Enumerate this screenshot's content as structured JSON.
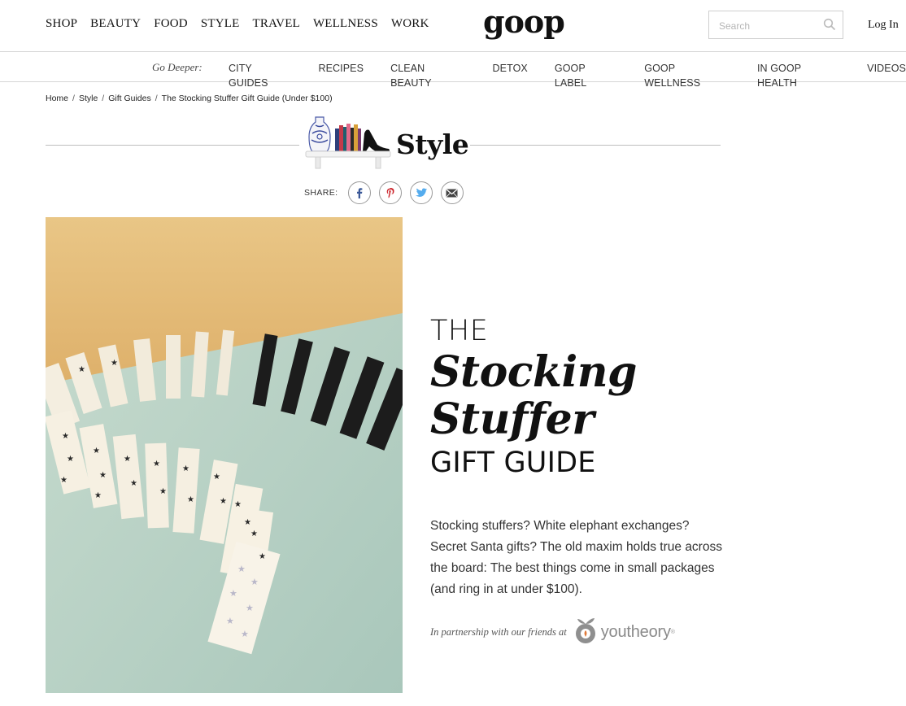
{
  "header": {
    "nav": [
      "SHOP",
      "BEAUTY",
      "FOOD",
      "STYLE",
      "TRAVEL",
      "WELLNESS",
      "WORK"
    ],
    "logo": "goop",
    "search_placeholder": "Search",
    "search_icon": "search-icon",
    "login": "Log In"
  },
  "subnav": {
    "label": "Go Deeper:",
    "items": [
      "CITY GUIDES",
      "RECIPES",
      "CLEAN BEAUTY",
      "DETOX",
      "GOOP LABEL",
      "GOOP WELLNESS",
      "IN GOOP HEALTH",
      "VIDEOS"
    ]
  },
  "breadcrumb": [
    "Home",
    "Style",
    "Gift Guides",
    "The Stocking Stuffer Gift Guide (Under $100)"
  ],
  "section": {
    "title": "Style",
    "icon": "bookshelf-icon"
  },
  "share": {
    "label": "SHARE:",
    "icons": [
      "facebook-icon",
      "pinterest-icon",
      "twitter-icon",
      "email-icon"
    ],
    "colors": {
      "facebook": "#3b5998",
      "pinterest": "#cb2027",
      "twitter": "#55acee",
      "email": "#444444"
    }
  },
  "hero": {
    "line1": "THE",
    "line2": "Stocking",
    "line3": "Stuffer",
    "line4": "GIFT GUIDE",
    "description": "Stocking stuffers? White elephant exchanges? Secret Santa gifts? The old maxim holds true across the board: The best things come in small packages (and ring in at under $100).",
    "partner_text": "In partnership with our friends at",
    "partner_name": "youtheory",
    "partner_tm": "®"
  }
}
